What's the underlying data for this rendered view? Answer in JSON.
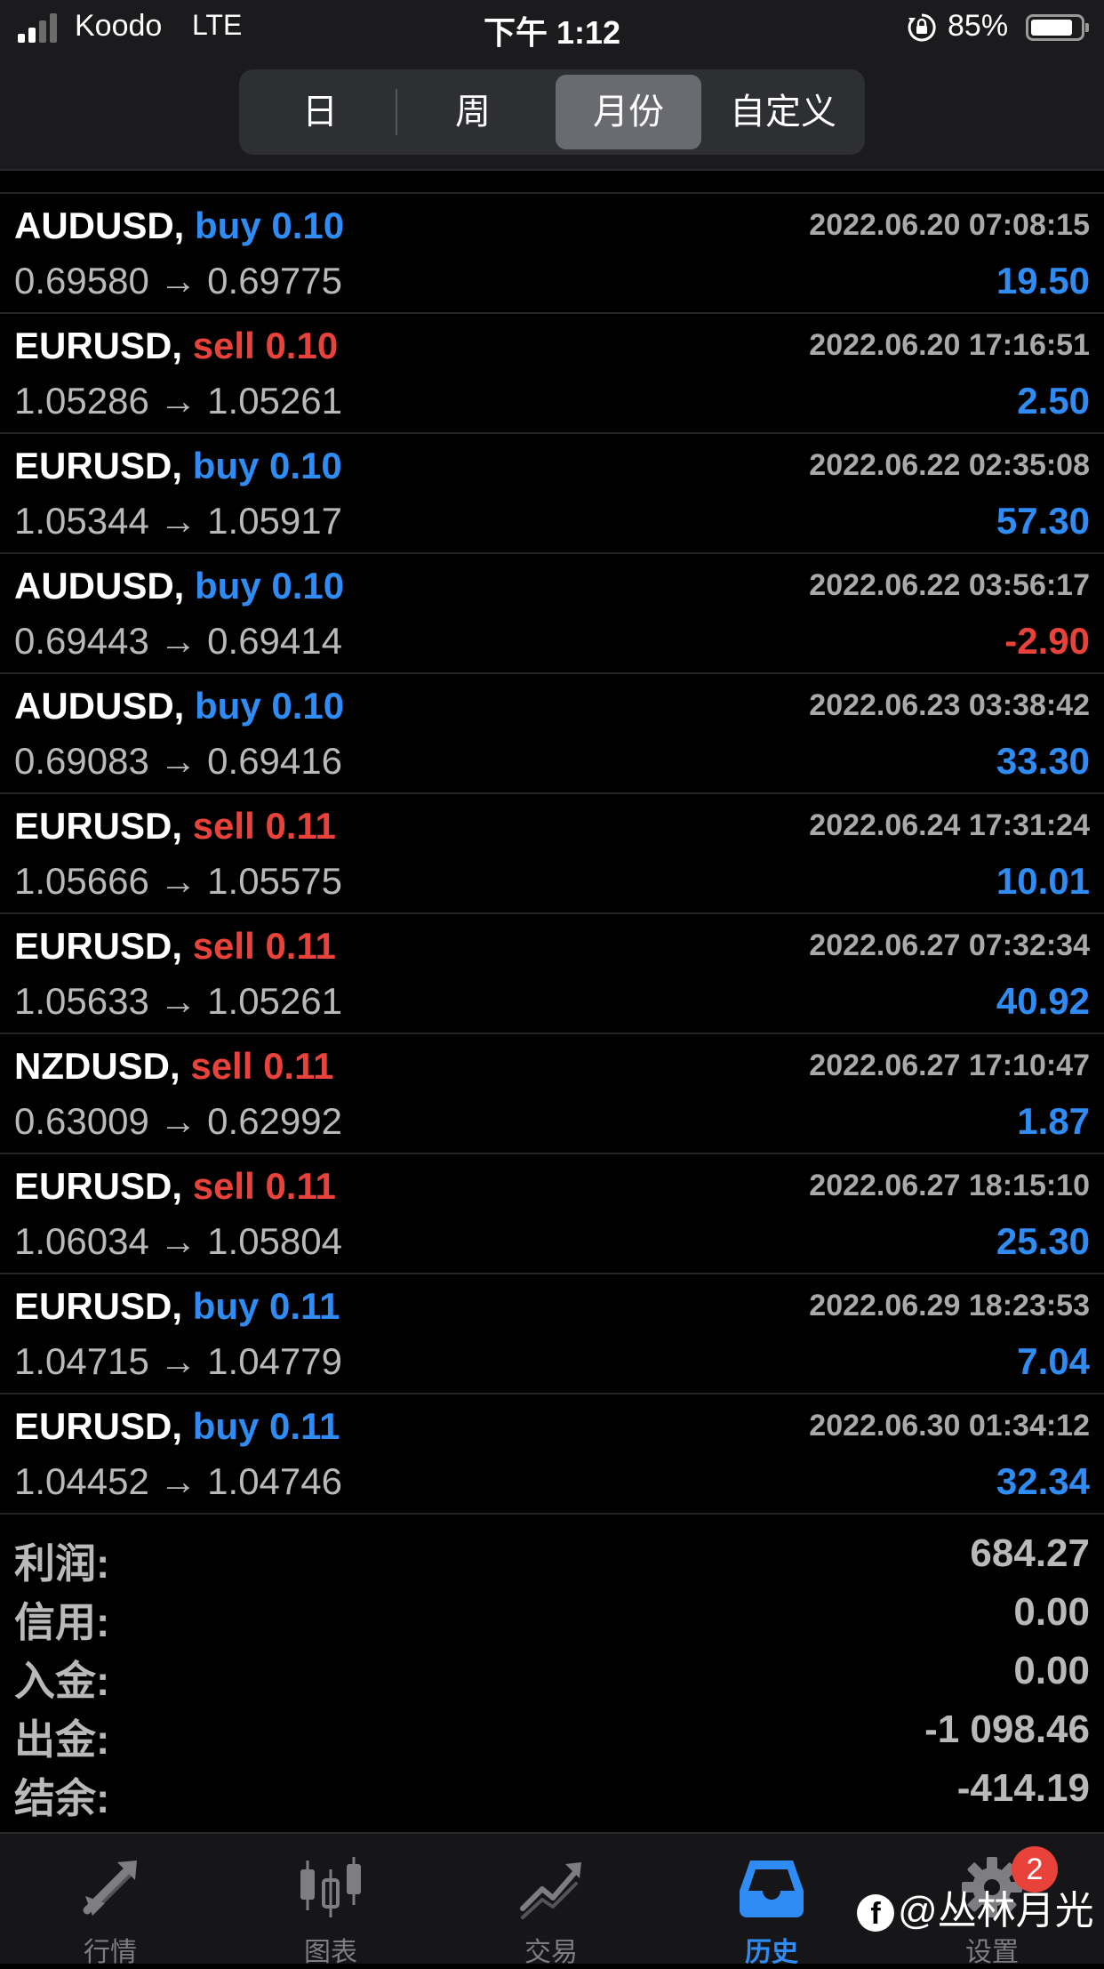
{
  "status_bar": {
    "carrier": "Koodo",
    "network": "LTE",
    "time": "下午 1:12",
    "battery_percent": "85%",
    "battery_level": 0.85,
    "signal_bars_active": 2,
    "signal_bars_total": 4
  },
  "period_tabs": [
    {
      "label": "日",
      "active": false
    },
    {
      "label": "周",
      "active": false
    },
    {
      "label": "月份",
      "active": true
    },
    {
      "label": "自定义",
      "active": false
    }
  ],
  "trades": [
    {
      "symbol": "AUDUSD,",
      "side": "buy",
      "volume": "0.10",
      "time": "2022.06.20 07:08:15",
      "open": "0.69580",
      "close": "0.69775",
      "profit": "19.50"
    },
    {
      "symbol": "EURUSD,",
      "side": "sell",
      "volume": "0.10",
      "time": "2022.06.20 17:16:51",
      "open": "1.05286",
      "close": "1.05261",
      "profit": "2.50"
    },
    {
      "symbol": "EURUSD,",
      "side": "buy",
      "volume": "0.10",
      "time": "2022.06.22 02:35:08",
      "open": "1.05344",
      "close": "1.05917",
      "profit": "57.30"
    },
    {
      "symbol": "AUDUSD,",
      "side": "buy",
      "volume": "0.10",
      "time": "2022.06.22 03:56:17",
      "open": "0.69443",
      "close": "0.69414",
      "profit": "-2.90"
    },
    {
      "symbol": "AUDUSD,",
      "side": "buy",
      "volume": "0.10",
      "time": "2022.06.23 03:38:42",
      "open": "0.69083",
      "close": "0.69416",
      "profit": "33.30"
    },
    {
      "symbol": "EURUSD,",
      "side": "sell",
      "volume": "0.11",
      "time": "2022.06.24 17:31:24",
      "open": "1.05666",
      "close": "1.05575",
      "profit": "10.01"
    },
    {
      "symbol": "EURUSD,",
      "side": "sell",
      "volume": "0.11",
      "time": "2022.06.27 07:32:34",
      "open": "1.05633",
      "close": "1.05261",
      "profit": "40.92"
    },
    {
      "symbol": "NZDUSD,",
      "side": "sell",
      "volume": "0.11",
      "time": "2022.06.27 17:10:47",
      "open": "0.63009",
      "close": "0.62992",
      "profit": "1.87"
    },
    {
      "symbol": "EURUSD,",
      "side": "sell",
      "volume": "0.11",
      "time": "2022.06.27 18:15:10",
      "open": "1.06034",
      "close": "1.05804",
      "profit": "25.30"
    },
    {
      "symbol": "EURUSD,",
      "side": "buy",
      "volume": "0.11",
      "time": "2022.06.29 18:23:53",
      "open": "1.04715",
      "close": "1.04779",
      "profit": "7.04"
    },
    {
      "symbol": "EURUSD,",
      "side": "buy",
      "volume": "0.11",
      "time": "2022.06.30 01:34:12",
      "open": "1.04452",
      "close": "1.04746",
      "profit": "32.34"
    }
  ],
  "arrow": "→",
  "summary": [
    {
      "label": "利润:",
      "value": "684.27"
    },
    {
      "label": "信用:",
      "value": "0.00"
    },
    {
      "label": "入金:",
      "value": "0.00"
    },
    {
      "label": "出金:",
      "value": "-1 098.46"
    },
    {
      "label": "结余:",
      "value": "-414.19"
    }
  ],
  "tabbar": [
    {
      "label": "行情",
      "icon": "quotes-arrows-icon",
      "active": false
    },
    {
      "label": "图表",
      "icon": "candlestick-chart-icon",
      "active": false
    },
    {
      "label": "交易",
      "icon": "trade-trend-icon",
      "active": false
    },
    {
      "label": "历史",
      "icon": "history-inbox-icon",
      "active": true
    },
    {
      "label": "设置",
      "icon": "gear-icon",
      "active": false
    }
  ],
  "settings_badge": "2",
  "watermark": {
    "text": "@丛林月光",
    "icon": "facebook-logo-icon"
  },
  "colors": {
    "buy": "#2f8cf5",
    "sell": "#e8423b",
    "background": "#000000",
    "muted": "#b9b9b9"
  }
}
